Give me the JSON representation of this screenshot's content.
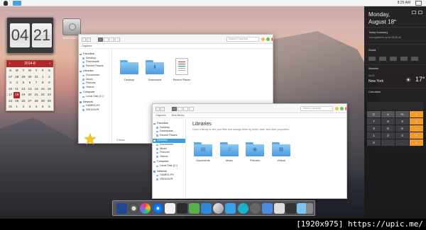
{
  "topbar": {
    "time": "8:25 AM"
  },
  "flip_clock": {
    "hour": "04",
    "minute": "21"
  },
  "drive": {
    "label": "BOOTCAMP (C:)"
  },
  "calendar": {
    "title": "2014-8",
    "day_headers": [
      "S",
      "M",
      "T",
      "W",
      "T",
      "F",
      "S"
    ],
    "days": [
      "27",
      "28",
      "29",
      "30",
      "31",
      "1",
      "2",
      "3",
      "4",
      "5",
      "6",
      "7",
      "8",
      "9",
      "10",
      "11",
      "12",
      "13",
      "14",
      "15",
      "16",
      "17",
      "18",
      "19",
      "20",
      "21",
      "22",
      "23",
      "24",
      "25",
      "26",
      "27",
      "28",
      "29",
      "30",
      "31",
      "1",
      "2",
      "3",
      "4",
      "5",
      "6"
    ],
    "today": "18"
  },
  "window_favorites": {
    "search_placeholder": "Search Favorites",
    "organize": "Organize",
    "sidebar": [
      {
        "label": "Favorites",
        "head": true
      },
      {
        "label": "Desktop"
      },
      {
        "label": "Downloads"
      },
      {
        "label": "Recent Places"
      },
      {
        "label": "Libraries",
        "head": true
      },
      {
        "label": "Documents"
      },
      {
        "label": "Music"
      },
      {
        "label": "Pictures"
      },
      {
        "label": "Videos"
      },
      {
        "label": "Computer",
        "head": true
      },
      {
        "label": "Local Disk (C:)"
      },
      {
        "label": "Network",
        "head": true
      },
      {
        "label": "HAMED-PC"
      },
      {
        "label": "VBOXSVR"
      }
    ],
    "items": [
      {
        "label": "Desktop",
        "glyph": ""
      },
      {
        "label": "Downloads",
        "glyph": "⬇"
      },
      {
        "label": "Recent Places",
        "glyph": ""
      }
    ],
    "status": "3 items"
  },
  "window_libraries": {
    "search_placeholder": "Search Libraries",
    "organize": "Organize",
    "new_library": "New library",
    "title": "Libraries",
    "subtitle": "Open a library to see your files and arrange them by folder, date, and other properties.",
    "sidebar": [
      {
        "label": "Favorites",
        "head": true
      },
      {
        "label": "Desktop"
      },
      {
        "label": "Downloads"
      },
      {
        "label": "Recent Places"
      },
      {
        "label": "Libraries",
        "head": true,
        "selected": true
      },
      {
        "label": "Documents"
      },
      {
        "label": "Music"
      },
      {
        "label": "Pictures"
      },
      {
        "label": "Videos"
      },
      {
        "label": "Computer",
        "head": true
      },
      {
        "label": "Local Disk (C:)"
      },
      {
        "label": "Network",
        "head": true
      },
      {
        "label": "HAMED-PC"
      },
      {
        "label": "VBOXSVR"
      }
    ],
    "items": [
      {
        "label": "Documents",
        "glyph": "▤"
      },
      {
        "label": "Music",
        "glyph": "♫"
      },
      {
        "label": "Pictures",
        "glyph": "◉"
      },
      {
        "label": "Videos",
        "glyph": "▦"
      }
    ]
  },
  "right_panel": {
    "day": "Monday,",
    "date": "August 18",
    "date_suffix": "th",
    "summary_title": "Today Summary",
    "summary_text": "Your system is up for 02:40:42",
    "social": "Social",
    "weather": "Weather",
    "weather_time": "04:21",
    "city": "New York",
    "temperature": "17°",
    "calculator": "Calculator",
    "calc_keys": [
      "C",
      "±",
      "%",
      "÷",
      "7",
      "8",
      "9",
      "×",
      "4",
      "5",
      "6",
      "−",
      "1",
      "2",
      "3",
      "+",
      "0",
      "",
      ".",
      "="
    ]
  },
  "watermark": {
    "text": "[1920x975] https://upic.me/"
  },
  "colors": {
    "accent": "#3f9ee0",
    "calendar_red": "#b2272a",
    "calc_orange": "#f19b2c"
  }
}
